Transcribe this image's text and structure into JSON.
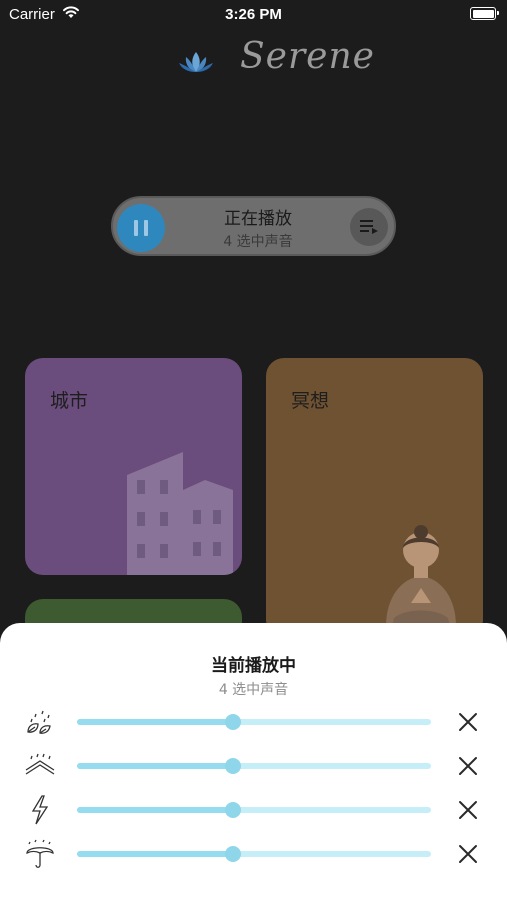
{
  "status_bar": {
    "carrier": "Carrier",
    "time": "3:26 PM",
    "icons": [
      "wifi-icon",
      "battery-icon"
    ]
  },
  "header": {
    "logo_text": "Serene",
    "logo_icon": "lotus-icon"
  },
  "now_playing": {
    "title": "正在播放",
    "subtitle": "4 选中声音",
    "pause_icon": "pause-icon",
    "queue_icon": "playlist-icon",
    "accent_color": "#2f88bd"
  },
  "categories": [
    {
      "label": "城市",
      "color": "#6a4d7c",
      "illustration": "city-buildings"
    },
    {
      "label": "冥想",
      "color": "#6f5232",
      "illustration": "meditating-buddha"
    },
    {
      "label": "",
      "color": "#3d5a30",
      "illustration": ""
    }
  ],
  "sheet": {
    "title": "当前播放中",
    "subtitle": "4 选中声音",
    "sounds": [
      {
        "icon": "rain-leaves-icon",
        "volume": 0.44,
        "remove_icon": "close-icon"
      },
      {
        "icon": "rain-roof-icon",
        "volume": 0.44,
        "remove_icon": "close-icon"
      },
      {
        "icon": "thunder-icon",
        "volume": 0.44,
        "remove_icon": "close-icon"
      },
      {
        "icon": "umbrella-rain-icon",
        "volume": 0.44,
        "remove_icon": "close-icon"
      }
    ],
    "slider_track_color": "#c6eef8",
    "slider_fill_color": "#96dcef"
  }
}
